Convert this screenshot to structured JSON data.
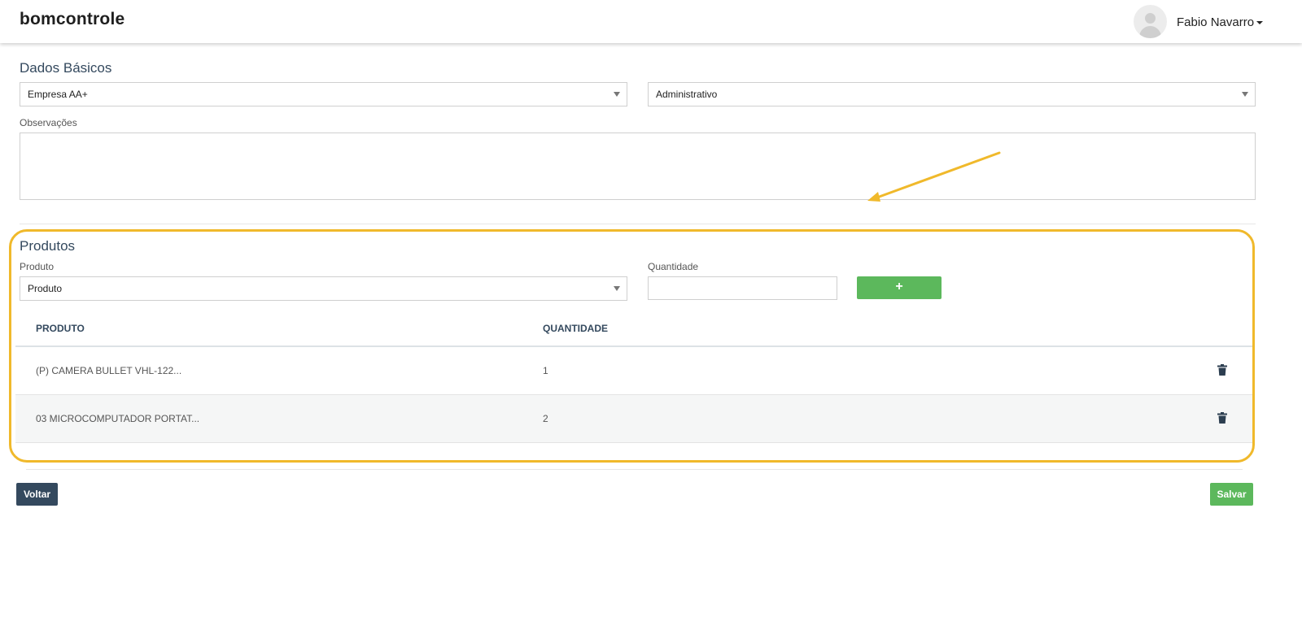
{
  "header": {
    "logo_text": "bomcontrole",
    "user_name": "Fabio Navarro",
    "avatar_icon": "user-avatar-icon"
  },
  "dados_basicos": {
    "title": "Dados Básicos",
    "empresa_value": "Empresa AA+",
    "departamento_value": "Administrativo",
    "observacoes_label": "Observações",
    "observacoes_value": ""
  },
  "produtos": {
    "title": "Produtos",
    "produto_label": "Produto",
    "produto_value": "Produto",
    "quantidade_label": "Quantidade",
    "quantidade_value": "",
    "add_label": "+",
    "columns": [
      "PRODUTO",
      "QUANTIDADE"
    ],
    "rows": [
      {
        "produto": "(P) CAMERA BULLET VHL-122...",
        "quantidade": "1"
      },
      {
        "produto": "03 MICROCOMPUTADOR PORTAT...",
        "quantidade": "2"
      }
    ],
    "delete_icon": "trash-icon"
  },
  "footer": {
    "back_label": "Voltar",
    "save_label": "Salvar"
  },
  "colors": {
    "primary_dark": "#34495e",
    "success": "#5cb85c",
    "highlight": "#f0b92b"
  }
}
